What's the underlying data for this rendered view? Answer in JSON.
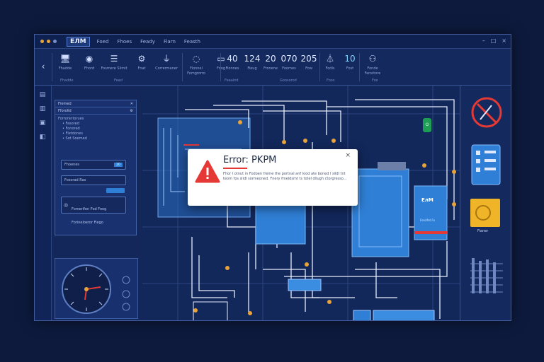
{
  "app": {
    "brand": "ЕЛМ"
  },
  "menu": [
    "Foed",
    "Fhoes",
    "Feady",
    "Fiarn",
    "Feasth"
  ],
  "window_controls": [
    "–",
    "□",
    "×"
  ],
  "ribbon": {
    "buttons": [
      {
        "label": "Fhadde",
        "icon": "monitor-icon"
      },
      {
        "label": "Fhord",
        "icon": "gauge-icon"
      },
      {
        "label": "Fosmere Slimit",
        "icon": "list-icon"
      },
      {
        "label": "Fnat",
        "icon": "tools-icon"
      },
      {
        "label": "Corrermaner",
        "icon": "plug-icon"
      },
      {
        "label": "Fionnel Fomgrorro",
        "icon": "bulb-icon"
      },
      {
        "label": "Foog",
        "icon": "window-icon"
      },
      {
        "label": "Fionnes",
        "icon": "number-icon",
        "value": "40"
      },
      {
        "label": "Fieug",
        "icon": "number-icon",
        "value": "124"
      },
      {
        "label": "Fronene",
        "icon": "number-icon",
        "value": "20"
      },
      {
        "label": "Foornes",
        "icon": "number-icon",
        "value": "070"
      },
      {
        "label": "Fow",
        "icon": "number-icon",
        "value": "205"
      },
      {
        "label": "Fodis",
        "icon": "sensor-icon"
      },
      {
        "label": "Fost",
        "icon": "number-icon",
        "value": "10"
      },
      {
        "label": "Fonde Fansitore",
        "icon": "network-icon"
      }
    ],
    "groups": [
      "Fhadde",
      "Fead",
      "Feaalnd",
      "Goosorod",
      "Foos",
      "Foo"
    ]
  },
  "panel": {
    "title": "Fremed",
    "search": "Fforolid",
    "tree": [
      "Forronintorues",
      "• Fasored",
      "• Fonored",
      "• Fletdones",
      "• Sot Soemed"
    ],
    "box1": {
      "label": "Fhoenes",
      "value": "10"
    },
    "box2": {
      "label": "Fosorad Ras"
    },
    "box3": {
      "label": "Fomerifen Fod Foog Forineloeror Fiego"
    }
  },
  "dialog": {
    "title": "Error: PKPM",
    "close": "×",
    "message": "Fhor l otnut in Fodoen freme the portnal anf lood ate boned l sildl tnt teom fos slidl sormeoned. Fnery fmeldsmt ts totel dilugh ctorgresso..."
  },
  "canvas": {
    "device1_label": "ЕлМ",
    "device1_sub": "Ferolfet Fo"
  },
  "rightpanel": {
    "yellow_label": "Fianer"
  },
  "colors": {
    "accent": "#2f7fd6",
    "error": "#e53935",
    "bg": "#0d1a3d",
    "panel": "#13275a"
  }
}
